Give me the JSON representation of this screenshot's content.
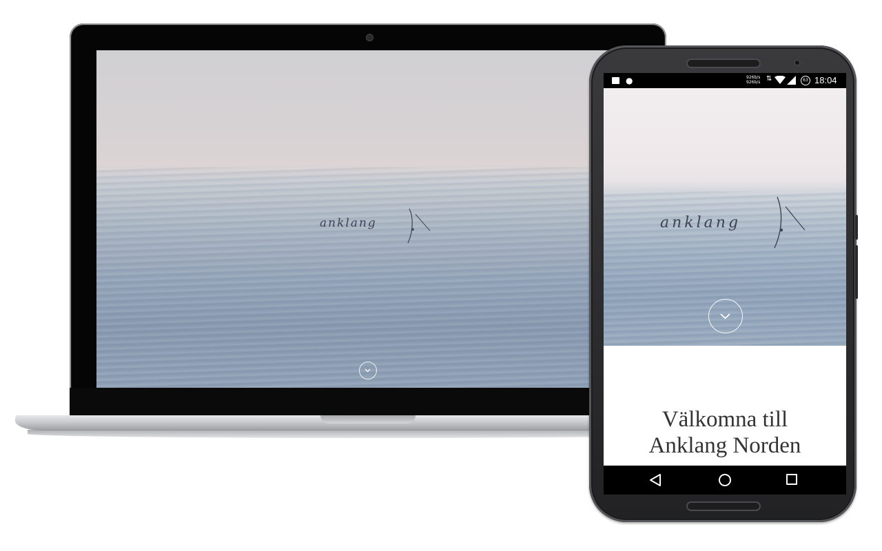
{
  "laptop": {
    "site": {
      "logo_text": "anklang",
      "scroll_icon": "chevron-down-icon"
    }
  },
  "phone": {
    "status_bar": {
      "left_icons": [
        "image-icon",
        "drop-icon"
      ],
      "speed_up": "926b/s",
      "speed_down": "926b/s",
      "arrows": "⇅",
      "battery": "63",
      "time": "18:04"
    },
    "site": {
      "logo_text": "anklang",
      "scroll_icon": "chevron-down-icon",
      "welcome_line1": "Välkomna till",
      "welcome_line2": "Anklang Norden"
    },
    "nav_bar": {
      "back_icon": "back-triangle-icon",
      "home_icon": "home-circle-icon",
      "recent_icon": "recent-square-icon"
    }
  },
  "colors": {
    "sky": "#dcd4d5",
    "water": "#8fa0b5",
    "logo_ink": "#3d4254",
    "heading": "#333333"
  }
}
